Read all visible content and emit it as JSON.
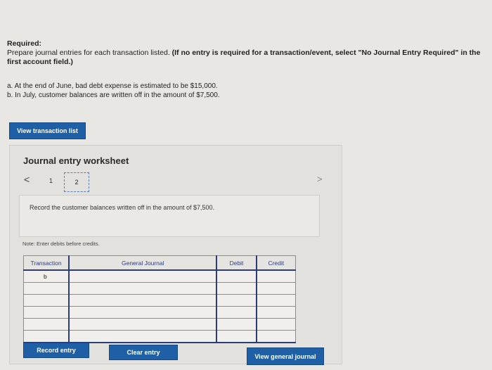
{
  "header": {
    "required_label": "Required:",
    "instruction_plain": "Prepare journal entries for each transaction listed.",
    "instruction_bold": "(If no entry is required for a transaction/event, select \"No Journal Entry Required\" in the first account field.)"
  },
  "transactions": {
    "a": "a. At the end of June, bad debt expense is estimated to be $15,000.",
    "b": "b. In July, customer balances are written off in the amount of $7,500."
  },
  "buttons": {
    "view_transaction_list": "View transaction list",
    "record_entry": "Record entry",
    "clear_entry": "Clear entry",
    "view_general_journal": "View general journal"
  },
  "worksheet": {
    "title": "Journal entry worksheet",
    "prev": "<",
    "next": ">",
    "pages": [
      "1",
      "2"
    ],
    "description": "Record the customer balances written off in the amount of $7,500.",
    "note": "Note: Enter debits before credits."
  },
  "table": {
    "headers": [
      "Transaction",
      "General Journal",
      "Debit",
      "Credit"
    ],
    "rows": [
      {
        "transaction": "b",
        "account": "",
        "debit": "",
        "credit": ""
      },
      {
        "transaction": "",
        "account": "",
        "debit": "",
        "credit": ""
      },
      {
        "transaction": "",
        "account": "",
        "debit": "",
        "credit": ""
      },
      {
        "transaction": "",
        "account": "",
        "debit": "",
        "credit": ""
      },
      {
        "transaction": "",
        "account": "",
        "debit": "",
        "credit": ""
      },
      {
        "transaction": "",
        "account": "",
        "debit": "",
        "credit": ""
      }
    ]
  },
  "colors": {
    "accent": "#1e5fa6",
    "table_border": "#2a3d7a"
  }
}
